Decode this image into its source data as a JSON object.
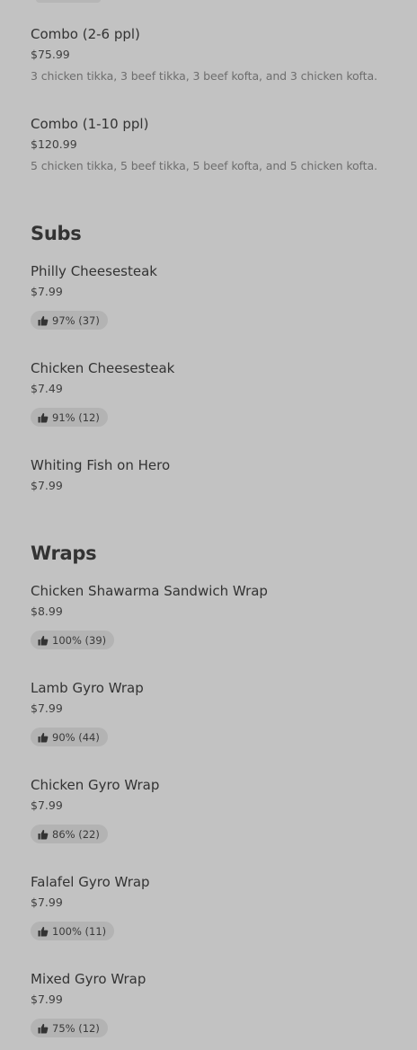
{
  "sections": {
    "combo": {
      "items": [
        {
          "name": "Combo (2-6 ppl)",
          "price": "$75.99",
          "description": "3 chicken tikka, 3 beef tikka, 3 beef kofta, and 3 chicken kofta."
        },
        {
          "name": "Combo (1-10 ppl)",
          "price": "$120.99",
          "description": "5 chicken tikka, 5 beef tikka, 5 beef kofta, and 5 chicken kofta."
        }
      ]
    },
    "subs": {
      "title": "Subs",
      "items": [
        {
          "name": "Philly Cheesesteak",
          "price": "$7.99",
          "rating": "97% (37)"
        },
        {
          "name": "Chicken Cheesesteak",
          "price": "$7.49",
          "rating": "91% (12)"
        },
        {
          "name": "Whiting Fish on Hero",
          "price": "$7.99"
        }
      ]
    },
    "wraps": {
      "title": "Wraps",
      "items": [
        {
          "name": "Chicken Shawarma Sandwich Wrap",
          "price": "$8.99",
          "rating": "100% (39)"
        },
        {
          "name": "Lamb Gyro Wrap",
          "price": "$7.99",
          "rating": "90% (44)"
        },
        {
          "name": "Chicken Gyro Wrap",
          "price": "$7.99",
          "rating": "86% (22)"
        },
        {
          "name": "Falafel Gyro Wrap",
          "price": "$7.99",
          "rating": "100% (11)"
        },
        {
          "name": "Mixed Gyro Wrap",
          "price": "$7.99",
          "rating": "75% (12)"
        }
      ]
    }
  },
  "icons": {
    "rating": "thumbs-up-icon"
  },
  "colors": {
    "background": "#c2c2c2",
    "badge": "#b3b3b3",
    "text": "#333333",
    "description": "#6d6d6d"
  }
}
